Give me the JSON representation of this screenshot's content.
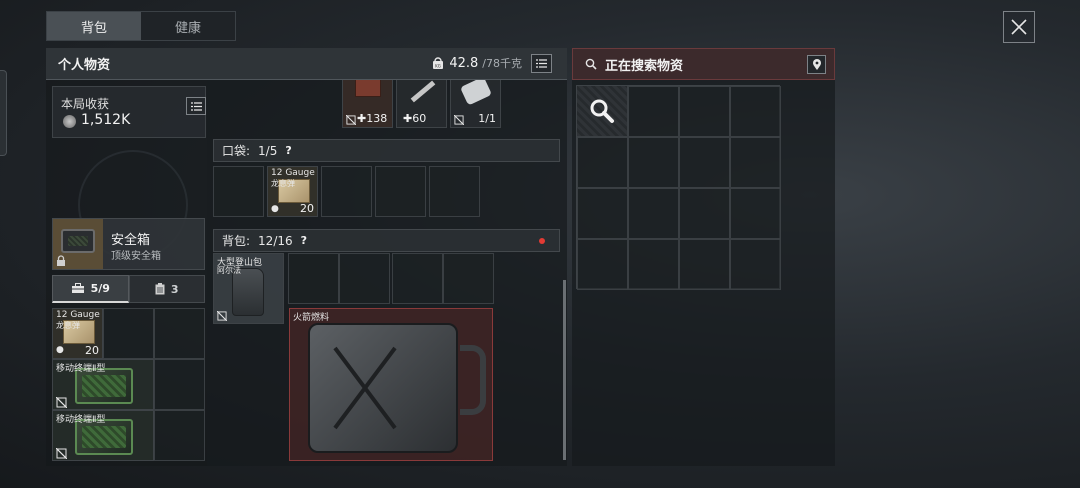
{
  "tabs": [
    {
      "label": "背包",
      "active": true
    },
    {
      "label": "健康",
      "active": false
    }
  ],
  "personal": {
    "title": "个人物资",
    "weight_current": "42.8",
    "weight_max": "/78千克"
  },
  "search": {
    "title": "正在搜索物资"
  },
  "earnings": {
    "label": "本局收获",
    "value": "1,512K"
  },
  "safe_box": {
    "name": "安全箱",
    "type": "顶级安全箱"
  },
  "subtabs": [
    {
      "label": "5/9",
      "icon": "toolbox-icon",
      "active": true
    },
    {
      "label": "3",
      "icon": "clipboard-icon",
      "active": false
    }
  ],
  "top_items": [
    {
      "count": "138",
      "icon": "medkit-icon"
    },
    {
      "count": "60",
      "icon": "syringe-icon"
    },
    {
      "count": "1/1",
      "icon": "pill-icon"
    }
  ],
  "pocket": {
    "label": "口袋:",
    "capacity": "1/5",
    "help": "?",
    "item": {
      "name": "12 Gauge",
      "sub": "龙息弹",
      "count": "20"
    }
  },
  "backpack": {
    "label": "背包:",
    "capacity": "12/16",
    "help": "?",
    "bag_item": {
      "name": "大型登山包",
      "sub": "阿尔法"
    },
    "fuel_item": {
      "name": "火箭燃料"
    }
  },
  "safe_items": [
    {
      "name": "12 Gauge",
      "sub": "龙息弹",
      "count": "20"
    },
    {
      "name": "移动终端Ⅱ型"
    },
    {
      "name": "移动终端Ⅱ型"
    }
  ],
  "colors": {
    "accent_red": "#6a3a3c",
    "tab_active": "#4a5055",
    "fuel_border": "#8a3a3a"
  }
}
